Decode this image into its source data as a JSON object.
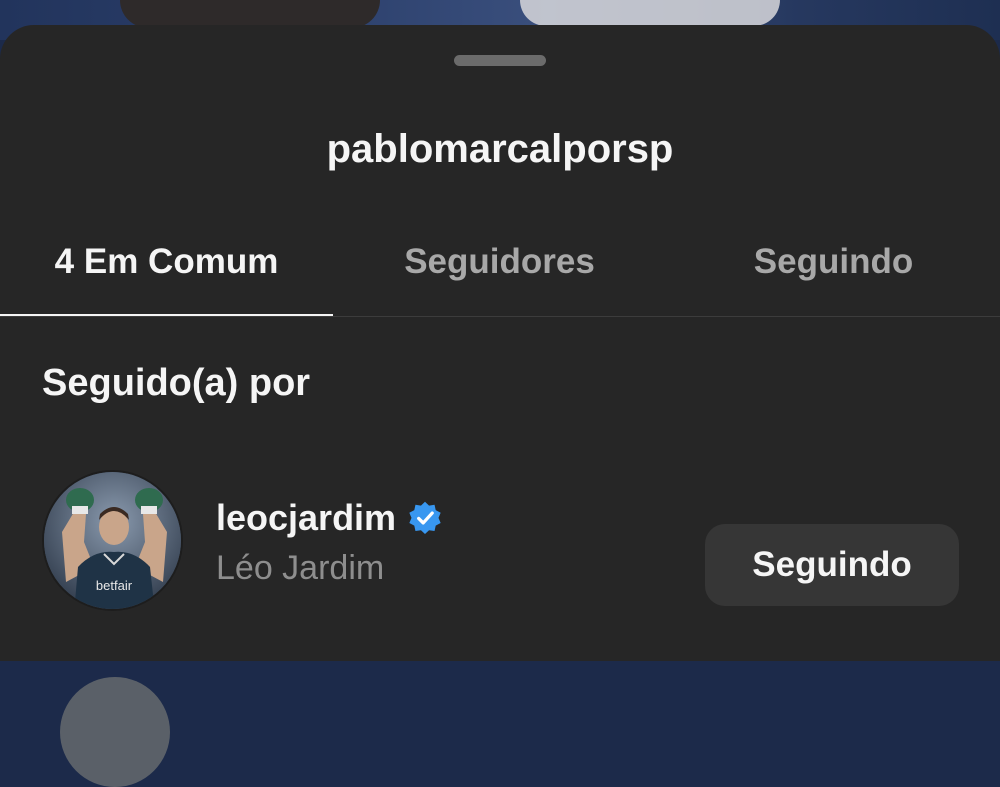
{
  "sheet": {
    "title": "pablomarcalporsp"
  },
  "tabs": [
    {
      "label": "4 Em Comum",
      "active": true
    },
    {
      "label": "Seguidores",
      "active": false
    },
    {
      "label": "Seguindo",
      "active": false
    }
  ],
  "section": {
    "heading": "Seguido(a) por"
  },
  "users": [
    {
      "username": "leocjardim",
      "full_name": "Léo Jardim",
      "verified": true,
      "button_label": "Seguindo",
      "avatar_icon": "profile-photo"
    }
  ],
  "colors": {
    "sheet_bg": "#262626",
    "text_primary": "#f5f5f5",
    "text_secondary": "#8e8e8e",
    "tab_inactive": "#a8a8a8",
    "button_bg": "#363636",
    "verified_blue": "#3897f0"
  }
}
